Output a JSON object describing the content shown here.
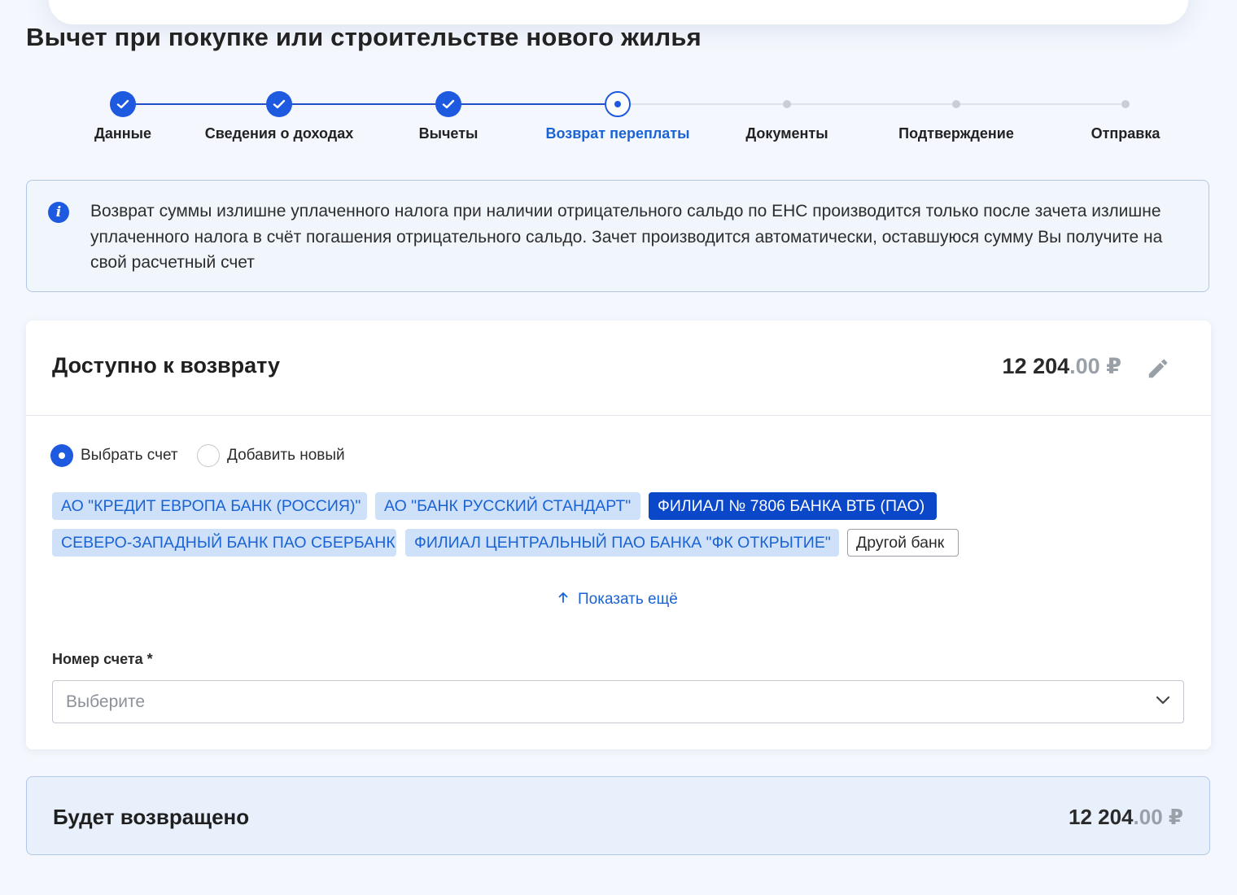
{
  "page": {
    "title": "Вычет при покупке или строительстве нового жилья"
  },
  "colors": {
    "accent": "#1e5ae0",
    "step_line_done": "#1e4fc9",
    "current_step_text": "#1a63d4",
    "chip_bg": "#cfe1f8",
    "chip_selected_bg": "#0b47c9",
    "info_bg": "#f1f6fd",
    "summary_bg": "#e8f0fc"
  },
  "stepper": {
    "steps": [
      {
        "label": "Данные",
        "state": "done"
      },
      {
        "label": "Сведения о доходах",
        "state": "done"
      },
      {
        "label": "Вычеты",
        "state": "done"
      },
      {
        "label": "Возврат переплаты",
        "state": "current"
      },
      {
        "label": "Документы",
        "state": "todo"
      },
      {
        "label": "Подтверждение",
        "state": "todo"
      },
      {
        "label": "Отправка",
        "state": "todo"
      }
    ]
  },
  "info": {
    "icon": "info-icon",
    "text": "Возврат суммы излишне уплаченного налога при наличии отрицательного сальдо по ЕНС производится только после зачета излишне уплаченного налога в счёт погашения отрицательного сальдо. Зачет производится автоматически, оставшуюся сумму Вы получите на свой расчетный счет"
  },
  "refund": {
    "title": "Доступно к возврату",
    "amount_int": "12 204",
    "amount_dec": ".00",
    "currency": "₽",
    "edit_icon": "pencil-icon"
  },
  "account_mode": {
    "options": [
      {
        "label": "Выбрать счет",
        "selected": true
      },
      {
        "label": "Добавить новый",
        "selected": false
      }
    ]
  },
  "banks": {
    "chips": [
      {
        "label": "АО \"КРЕДИТ ЕВРОПА БАНК (РОССИЯ)\"",
        "selected": false
      },
      {
        "label": "АО \"БАНК РУССКИЙ СТАНДАРТ\"",
        "selected": false
      },
      {
        "label": "ФИЛИАЛ № 7806 БАНКА ВТБ (ПАО)",
        "selected": true
      },
      {
        "label": "СЕВЕРО-ЗАПАДНЫЙ БАНК ПАО СБЕРБАНК",
        "selected": false
      },
      {
        "label": "ФИЛИАЛ ЦЕНТРАЛЬНЫЙ ПАО БАНКА \"ФК ОТКРЫТИЕ\"",
        "selected": false
      }
    ],
    "other_label": "Другой банк",
    "show_more": "Показать ещё"
  },
  "account_number": {
    "label": "Номер счета *",
    "placeholder": "Выберите",
    "value": ""
  },
  "summary": {
    "title": "Будет возвращено",
    "amount_int": "12 204",
    "amount_dec": ".00",
    "currency": "₽"
  }
}
